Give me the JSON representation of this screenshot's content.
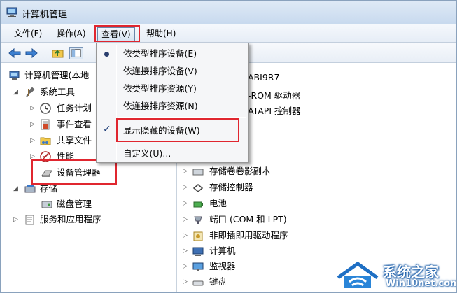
{
  "window": {
    "title": "计算机管理"
  },
  "menubar": {
    "file": "文件(F)",
    "action": "操作(A)",
    "view": "查看(V)",
    "help": "帮助(H)"
  },
  "tree": {
    "root": "计算机管理(本地",
    "system_tools": "系统工具",
    "task_scheduler": "任务计划",
    "event_viewer": "事件查看",
    "shared_folders": "共享文件",
    "performance": "性能",
    "device_manager": "设备管理器",
    "storage": "存储",
    "disk_management": "磁盘管理",
    "services_apps": "服务和应用程序"
  },
  "view_menu": {
    "by_type_devices": "依类型排序设备(E)",
    "by_connection_devices": "依连接排序设备(V)",
    "by_type_resources": "依类型排序资源(Y)",
    "by_connection_resources": "依连接排序资源(N)",
    "show_hidden": "显示隐藏的设备(W)",
    "customize": "自定义(U)..."
  },
  "devices": {
    "computer_name_partial": "ABI9R7",
    "dvd_partial": "-ROM 驱动器",
    "ide_partial": "ATAPI 控制器",
    "items": [
      "存储卷卷影副本",
      "存储控制器",
      "电池",
      "端口 (COM 和 LPT)",
      "非即插即用驱动程序",
      "计算机",
      "监视器",
      "键盘"
    ]
  },
  "watermark": {
    "line1": "系统之家",
    "line2": "Win10net.com"
  },
  "colors": {
    "highlight": "#e0262f",
    "title_bg": "#dfeaf6",
    "menu_bg": "#f5f6f8"
  }
}
